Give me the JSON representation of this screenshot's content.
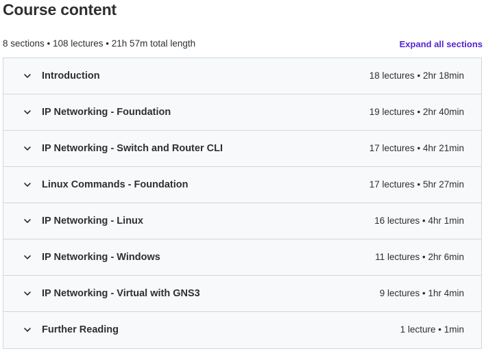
{
  "header": {
    "title": "Course content",
    "summary": "8 sections • 108 lectures • 21h 57m total length",
    "expand_all_label": "Expand all sections"
  },
  "sections": [
    {
      "title": "Introduction",
      "meta": "18 lectures • 2hr 18min"
    },
    {
      "title": "IP Networking - Foundation",
      "meta": "19 lectures • 2hr 40min"
    },
    {
      "title": "IP Networking - Switch and Router CLI",
      "meta": "17 lectures • 4hr 21min"
    },
    {
      "title": "Linux Commands - Foundation",
      "meta": "17 lectures • 5hr 27min"
    },
    {
      "title": "IP Networking - Linux",
      "meta": "16 lectures • 4hr 1min"
    },
    {
      "title": "IP Networking - Windows",
      "meta": "11 lectures • 2hr 6min"
    },
    {
      "title": "IP Networking - Virtual with GNS3",
      "meta": "9 lectures • 1hr 4min"
    },
    {
      "title": "Further Reading",
      "meta": "1 lecture • 1min"
    }
  ],
  "icons": {
    "section_toggle": "chevron-down-icon"
  },
  "colors": {
    "accent": "#5624d0",
    "text": "#2d2f31",
    "section_bg": "#f7f9fa",
    "border": "#d1d7dc"
  }
}
